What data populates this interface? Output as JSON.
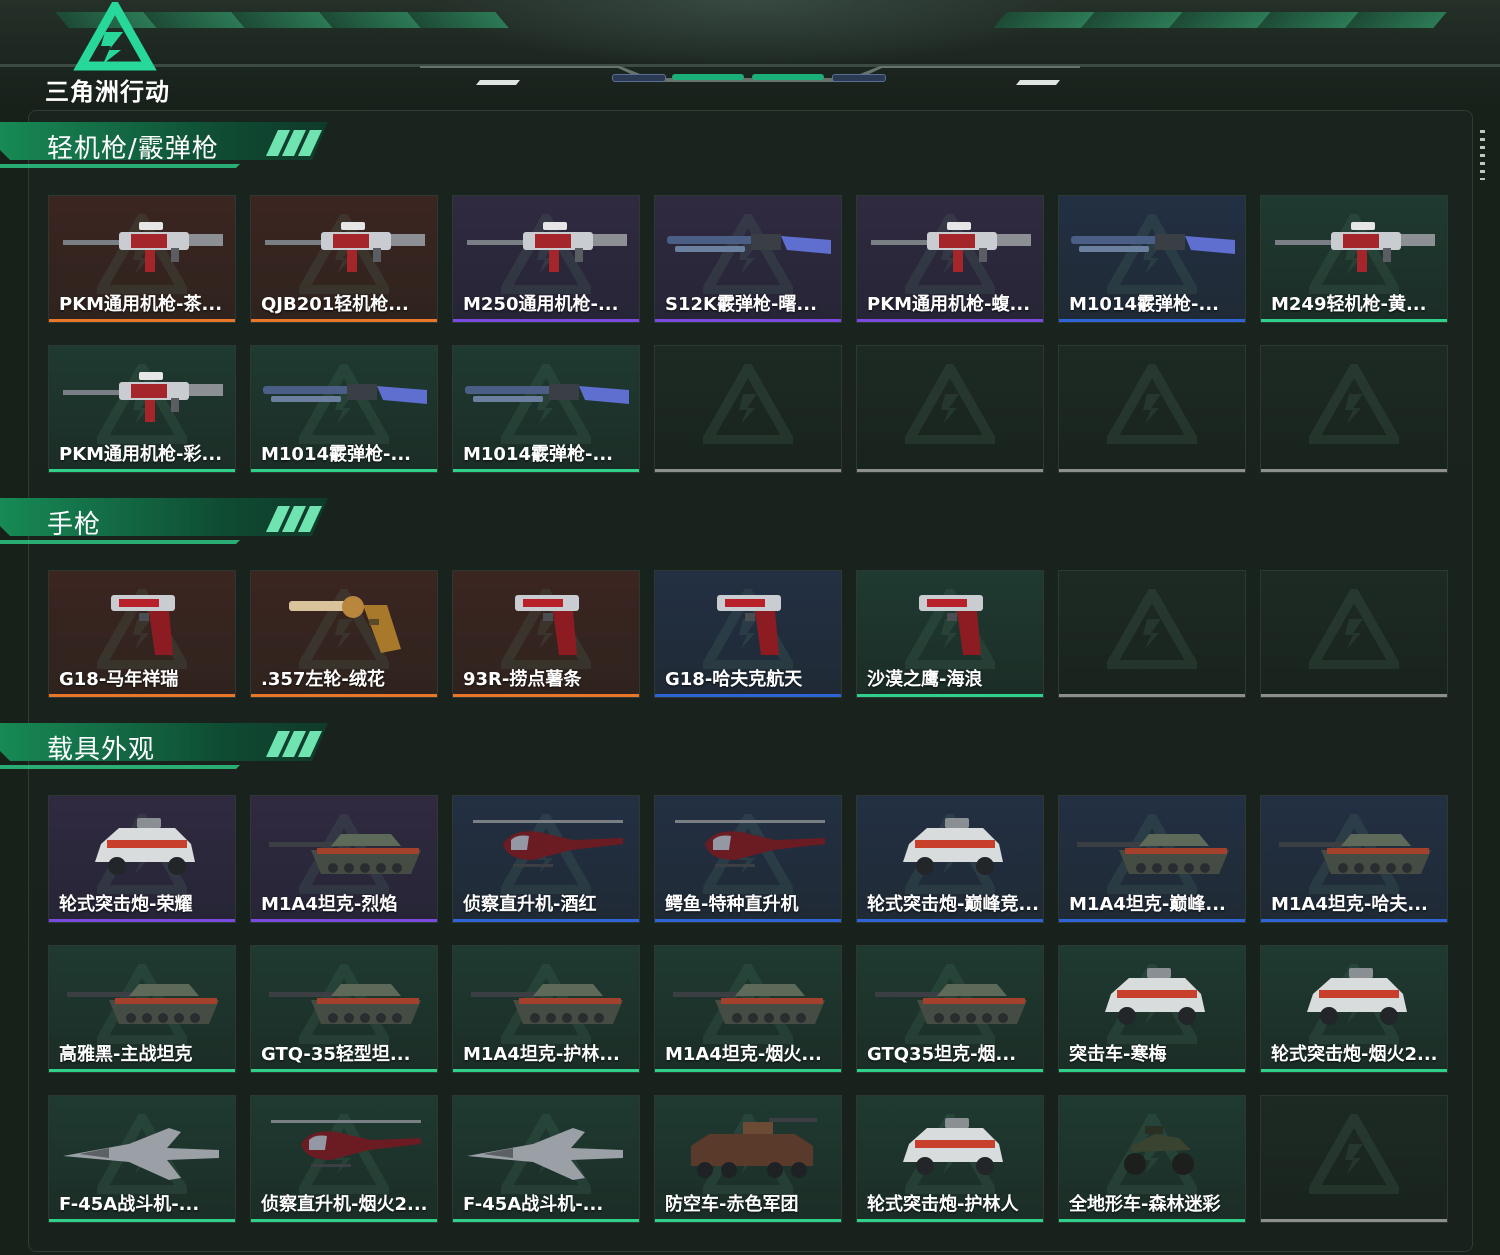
{
  "app": {
    "logo_text": "三角洲行动"
  },
  "colors": {
    "accent": "#2fd08a",
    "rarity_orange": "#e8772a",
    "rarity_purple": "#7a4ae0",
    "rarity_blue": "#2f64d6",
    "rarity_green": "#2fd08a",
    "empty_slot": "#8c8f8d"
  },
  "sections": [
    {
      "title": "轻机枪/霰弹枪",
      "items": [
        {
          "name": "PKM通用机枪-茶...",
          "rarity": "orange",
          "icon": "machine-gun-icon"
        },
        {
          "name": "QJB201轻机枪...",
          "rarity": "orange",
          "icon": "machine-gun-icon"
        },
        {
          "name": "M250通用机枪-...",
          "rarity": "purple",
          "icon": "machine-gun-icon"
        },
        {
          "name": "S12K霰弹枪-曙...",
          "rarity": "purple",
          "icon": "shotgun-icon"
        },
        {
          "name": "PKM通用机枪-蝮...",
          "rarity": "purple",
          "icon": "machine-gun-icon"
        },
        {
          "name": "M1014霰弹枪-...",
          "rarity": "blue",
          "icon": "shotgun-icon"
        },
        {
          "name": "M249轻机枪-黄...",
          "rarity": "green",
          "icon": "machine-gun-icon"
        },
        {
          "name": "PKM通用机枪-彩...",
          "rarity": "green",
          "icon": "machine-gun-icon"
        },
        {
          "name": "M1014霰弹枪-...",
          "rarity": "green",
          "icon": "shotgun-icon"
        },
        {
          "name": "M1014霰弹枪-...",
          "rarity": "green",
          "icon": "shotgun-icon"
        },
        {
          "name": "",
          "rarity": "empty",
          "icon": "empty-slot-icon"
        },
        {
          "name": "",
          "rarity": "empty",
          "icon": "empty-slot-icon"
        },
        {
          "name": "",
          "rarity": "empty",
          "icon": "empty-slot-icon"
        },
        {
          "name": "",
          "rarity": "empty",
          "icon": "empty-slot-icon"
        }
      ]
    },
    {
      "title": "手枪",
      "items": [
        {
          "name": "G18-马年祥瑞",
          "rarity": "orange",
          "icon": "pistol-icon"
        },
        {
          "name": ".357左轮-绒花",
          "rarity": "orange",
          "icon": "revolver-icon"
        },
        {
          "name": "93R-捞点薯条",
          "rarity": "orange",
          "icon": "pistol-icon"
        },
        {
          "name": "G18-哈夫克航天",
          "rarity": "blue",
          "icon": "pistol-icon"
        },
        {
          "name": "沙漠之鹰-海浪",
          "rarity": "green",
          "icon": "pistol-icon"
        },
        {
          "name": "",
          "rarity": "empty",
          "icon": "empty-slot-icon"
        },
        {
          "name": "",
          "rarity": "empty",
          "icon": "empty-slot-icon"
        }
      ]
    },
    {
      "title": "载具外观",
      "items": [
        {
          "name": "轮式突击炮-荣耀",
          "rarity": "purple",
          "icon": "armored-car-icon"
        },
        {
          "name": "M1A4坦克-烈焰",
          "rarity": "purple",
          "icon": "tank-icon"
        },
        {
          "name": "侦察直升机-酒红",
          "rarity": "blue",
          "icon": "helicopter-icon"
        },
        {
          "name": "鳄鱼-特种直升机",
          "rarity": "blue",
          "icon": "helicopter-icon"
        },
        {
          "name": "轮式突击炮-巅峰竞...",
          "rarity": "blue",
          "icon": "armored-car-icon"
        },
        {
          "name": "M1A4坦克-巅峰...",
          "rarity": "blue",
          "icon": "tank-icon"
        },
        {
          "name": "M1A4坦克-哈夫...",
          "rarity": "blue",
          "icon": "tank-icon"
        },
        {
          "name": "高雅黑-主战坦克",
          "rarity": "green",
          "icon": "tank-icon"
        },
        {
          "name": "GTQ-35轻型坦...",
          "rarity": "green",
          "icon": "tank-icon"
        },
        {
          "name": "M1A4坦克-护林...",
          "rarity": "green",
          "icon": "tank-icon"
        },
        {
          "name": "M1A4坦克-烟火...",
          "rarity": "green",
          "icon": "tank-icon"
        },
        {
          "name": "GTQ35坦克-烟...",
          "rarity": "green",
          "icon": "tank-icon"
        },
        {
          "name": "突击车-寒梅",
          "rarity": "green",
          "icon": "armored-car-icon"
        },
        {
          "name": "轮式突击炮-烟火2...",
          "rarity": "green",
          "icon": "armored-car-icon"
        },
        {
          "name": "F-45A战斗机-...",
          "rarity": "green",
          "icon": "jet-fighter-icon"
        },
        {
          "name": "侦察直升机-烟火2...",
          "rarity": "green",
          "icon": "helicopter-icon"
        },
        {
          "name": "F-45A战斗机-...",
          "rarity": "green",
          "icon": "jet-fighter-icon"
        },
        {
          "name": "防空车-赤色军团",
          "rarity": "green",
          "icon": "anti-air-vehicle-icon"
        },
        {
          "name": "轮式突击炮-护林人",
          "rarity": "green",
          "icon": "armored-car-icon"
        },
        {
          "name": "全地形车-森林迷彩",
          "rarity": "green",
          "icon": "atv-icon"
        },
        {
          "name": "",
          "rarity": "empty",
          "icon": "empty-slot-icon"
        }
      ]
    }
  ]
}
